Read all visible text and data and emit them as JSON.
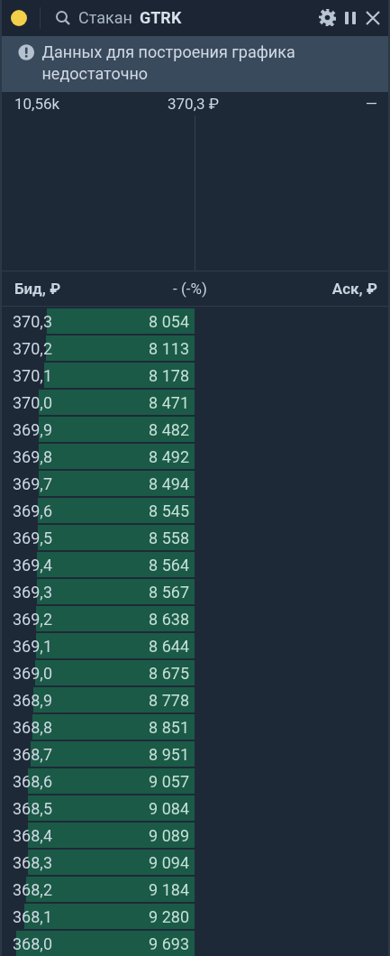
{
  "header": {
    "title": "Стакан",
    "ticker": "GTRK"
  },
  "notice": {
    "text": "Данных для построения графика недостаточно"
  },
  "summary": {
    "volume": "10,56k",
    "price": "370,3 ₽",
    "change": "—"
  },
  "table": {
    "columns": [
      "Бид, ₽",
      "- (-%)",
      "Аск, ₽"
    ],
    "rows": [
      {
        "price": "370,3",
        "volume": "8 054"
      },
      {
        "price": "370,2",
        "volume": "8 113"
      },
      {
        "price": "370,1",
        "volume": "8 178"
      },
      {
        "price": "370,0",
        "volume": "8 471"
      },
      {
        "price": "369,9",
        "volume": "8 482"
      },
      {
        "price": "369,8",
        "volume": "8 492"
      },
      {
        "price": "369,7",
        "volume": "8 494"
      },
      {
        "price": "369,6",
        "volume": "8 545"
      },
      {
        "price": "369,5",
        "volume": "8 558"
      },
      {
        "price": "369,4",
        "volume": "8 564"
      },
      {
        "price": "369,3",
        "volume": "8 567"
      },
      {
        "price": "369,2",
        "volume": "8 638"
      },
      {
        "price": "369,1",
        "volume": "8 644"
      },
      {
        "price": "369,0",
        "volume": "8 675"
      },
      {
        "price": "368,9",
        "volume": "8 778"
      },
      {
        "price": "368,8",
        "volume": "8 851"
      },
      {
        "price": "368,7",
        "volume": "8 951"
      },
      {
        "price": "368,6",
        "volume": "9 057"
      },
      {
        "price": "368,5",
        "volume": "9 084"
      },
      {
        "price": "368,4",
        "volume": "9 089"
      },
      {
        "price": "368,3",
        "volume": "9 094"
      },
      {
        "price": "368,2",
        "volume": "9 184"
      },
      {
        "price": "368,1",
        "volume": "9 280"
      },
      {
        "price": "368,0",
        "volume": "9 693"
      }
    ]
  }
}
